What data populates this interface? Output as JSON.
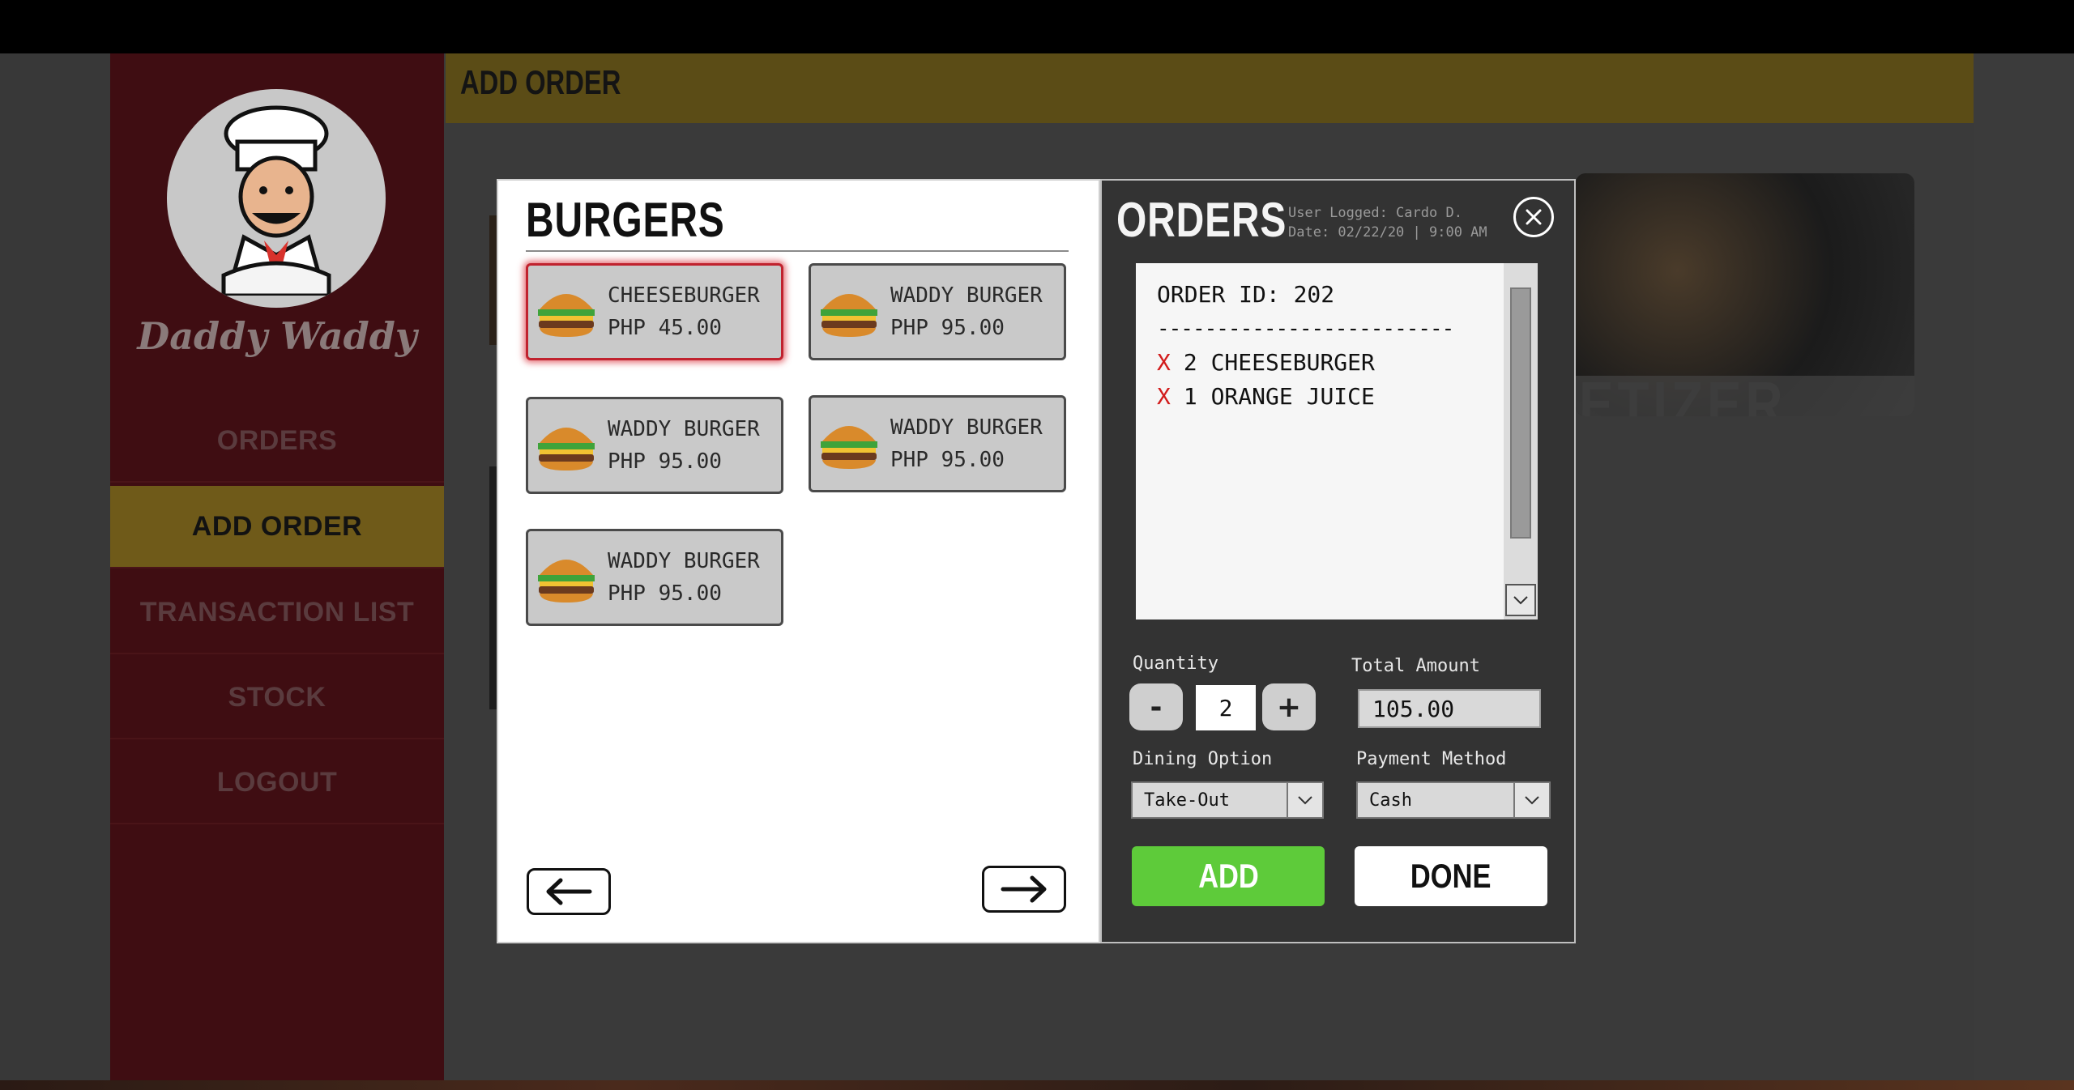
{
  "app": {
    "brand": "Daddy Waddy",
    "header_title": "ADD ORDER",
    "background_card_label": "ETIZER"
  },
  "sidebar": {
    "items": [
      {
        "label": "ORDERS",
        "active": false
      },
      {
        "label": "ADD ORDER",
        "active": true
      },
      {
        "label": "TRANSACTION LIST",
        "active": false
      },
      {
        "label": "STOCK",
        "active": false
      },
      {
        "label": "LOGOUT",
        "active": false
      }
    ]
  },
  "menu": {
    "category": "BURGERS",
    "items": [
      {
        "name": "CHEESEBURGER",
        "price": "PHP 45.00",
        "selected": true
      },
      {
        "name": "WADDY BURGER",
        "price": "PHP 95.00",
        "selected": false
      },
      {
        "name": "WADDY BURGER",
        "price": "PHP 95.00",
        "selected": false
      },
      {
        "name": "WADDY BURGER",
        "price": "PHP 95.00",
        "selected": false
      },
      {
        "name": "WADDY BURGER",
        "price": "PHP 95.00",
        "selected": false
      }
    ],
    "prev_icon": "arrow-left-icon",
    "next_icon": "arrow-right-icon"
  },
  "orders": {
    "title": "ORDERS",
    "user_logged": "User Logged: Cardo D.",
    "date": "Date: 02/22/20 | 9:00 AM",
    "order_id": "ORDER ID: 202",
    "separator": "-------------------------",
    "remove_mark": "X",
    "lines": [
      {
        "qty": "2",
        "item": "CHEESEBURGER"
      },
      {
        "qty": "1",
        "item": "ORANGE JUICE"
      }
    ],
    "quantity_label": "Quantity",
    "quantity_minus": "-",
    "quantity_value": "2",
    "quantity_plus": "+",
    "total_label": "Total Amount",
    "total_value": "105.00",
    "dining_label": "Dining Option",
    "dining_value": "Take-Out",
    "payment_label": "Payment Method",
    "payment_value": "Cash",
    "add_label": "ADD",
    "done_label": "DONE"
  },
  "colors": {
    "sidebar_bg": "#3f0d12",
    "active_nav": "#6f5a19",
    "header_bar": "#5b4c16",
    "add_button": "#5ecb3a",
    "selected_outline": "#c0222e",
    "remove_x": "#d21c1c"
  }
}
